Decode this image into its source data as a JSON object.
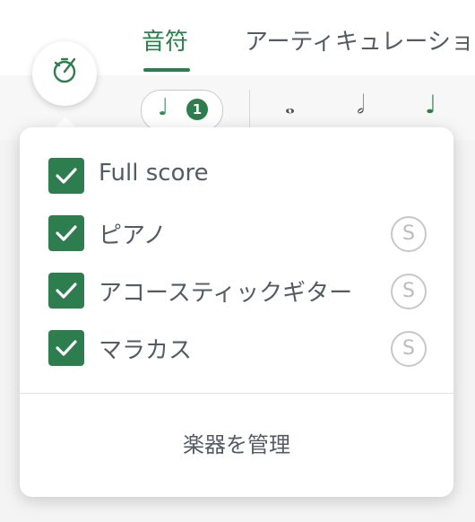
{
  "tabs": {
    "notes": "音符",
    "articulation": "アーティキュレーショ"
  },
  "toolbar": {
    "voice_number": "1"
  },
  "parts": [
    {
      "label": "Full score",
      "checked": true,
      "solo": ""
    },
    {
      "label": "ピアノ",
      "checked": true,
      "solo": "S"
    },
    {
      "label": "アコースティックギター",
      "checked": true,
      "solo": "S"
    },
    {
      "label": "マラカス",
      "checked": true,
      "solo": "S"
    }
  ],
  "manage_label": "楽器を管理",
  "colors": {
    "accent": "#2e7d4f",
    "text": "#555a64",
    "solo_border": "#c8c8c8"
  },
  "icons": {
    "metronome": "metronome-icon",
    "check": "check-icon"
  }
}
